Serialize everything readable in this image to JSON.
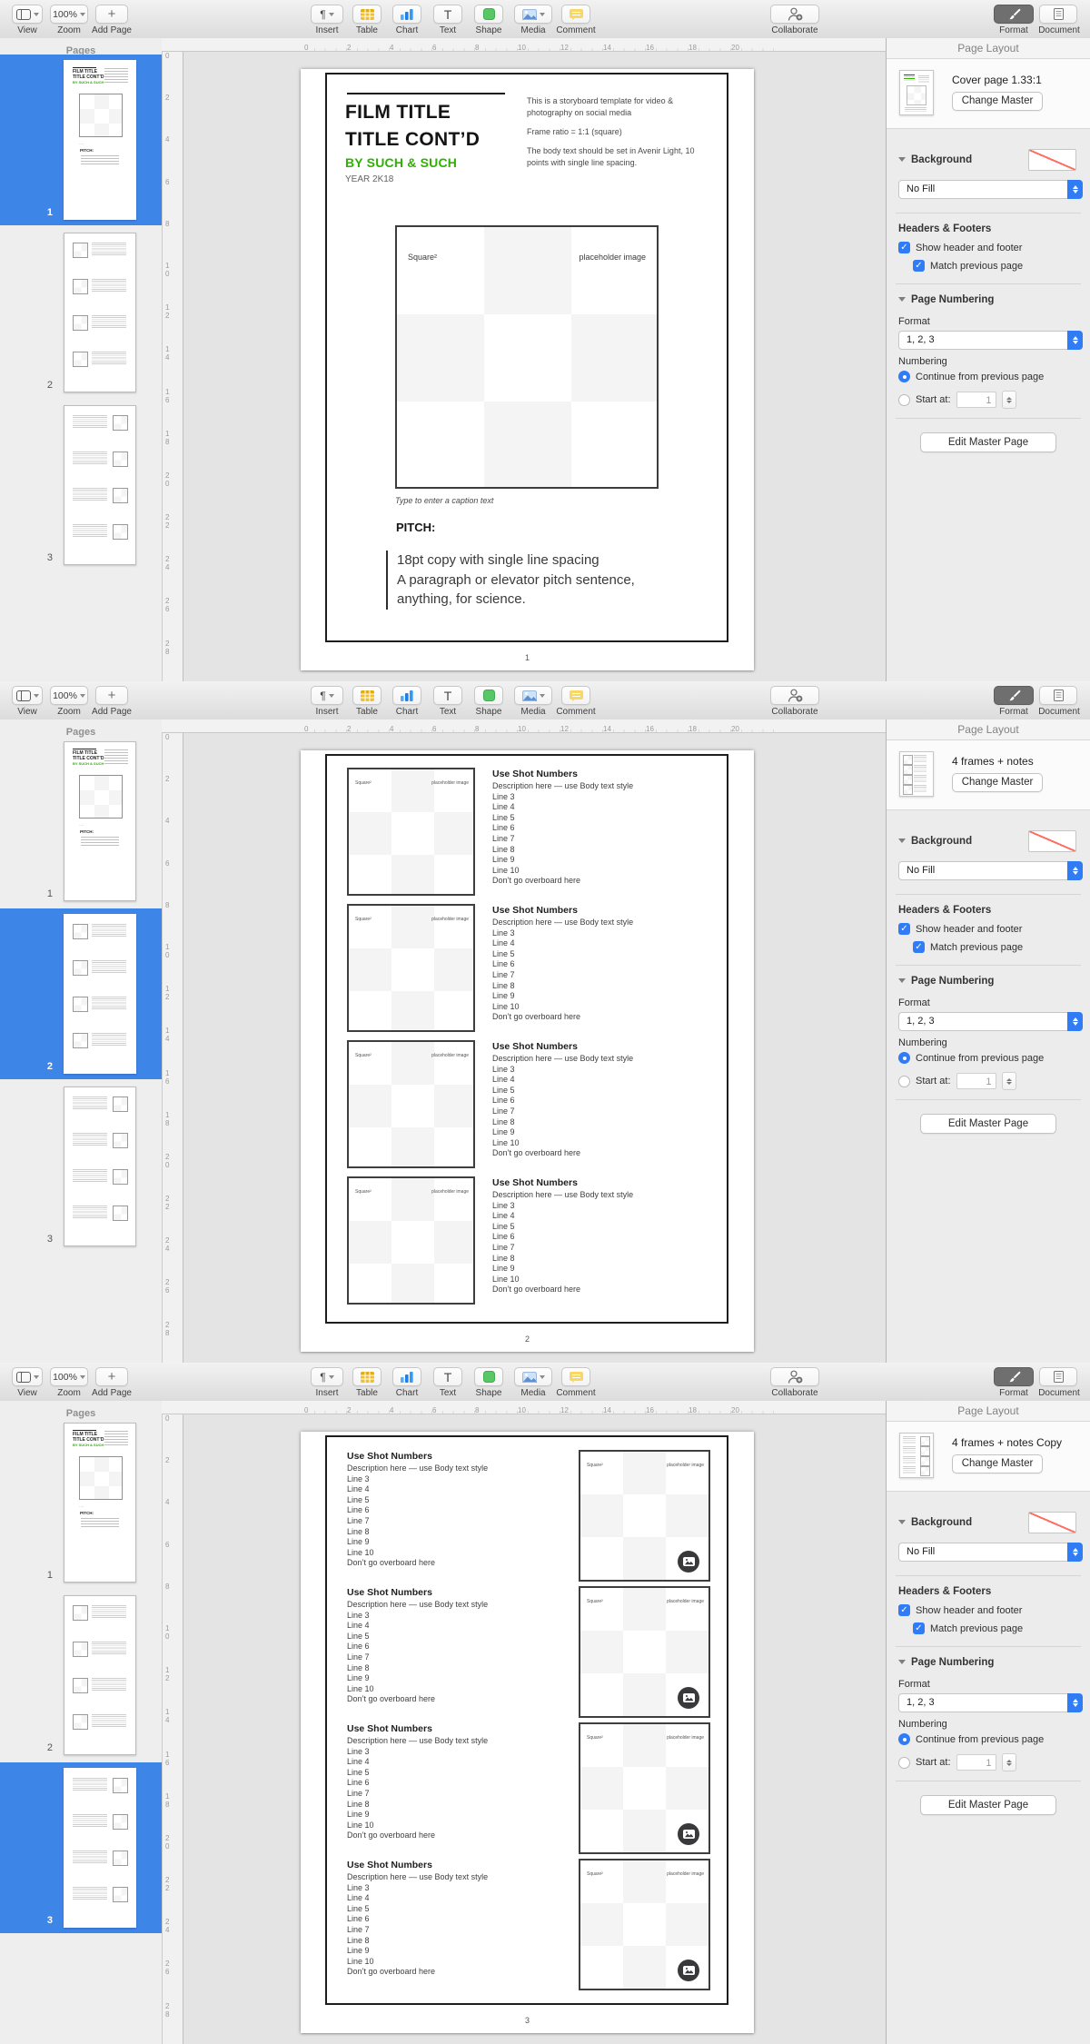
{
  "colors": {
    "selection_blue": "#3e85e8",
    "control_blue": "#2f7cf6",
    "accent_green": "#2db200",
    "no_fill_red": "#ff6e61",
    "table_yellow": "#f2c029",
    "chart_blue": "#2e9bf7",
    "shape_green": "#57c865",
    "comment_yellow": "#f8d864"
  },
  "toolbar": {
    "view_label": "View",
    "zoom_value": "100%",
    "zoom_label": "Zoom",
    "add_page_label": "Add Page",
    "insert_label": "Insert",
    "table_label": "Table",
    "chart_label": "Chart",
    "text_label": "Text",
    "shape_label": "Shape",
    "media_label": "Media",
    "comment_label": "Comment",
    "collaborate_label": "Collaborate",
    "format_label": "Format",
    "document_label": "Document"
  },
  "sidebar": {
    "title": "Pages",
    "page_labels": [
      "1",
      "2",
      "3"
    ]
  },
  "rulers": {
    "horizontal": [
      "0",
      "2",
      "4",
      "6",
      "8",
      "10",
      "12",
      "14",
      "16",
      "18",
      "20"
    ],
    "vertical": [
      "0",
      "2",
      "4",
      "6",
      "8",
      "10",
      "12",
      "14",
      "16",
      "18",
      "20",
      "22",
      "24",
      "26",
      "28"
    ]
  },
  "panel": {
    "title": "Page Layout",
    "change_master": "Change Master",
    "background_label": "Background",
    "background_fill": "No Fill",
    "headers_footers_title": "Headers & Footers",
    "show_header_footer": "Show header and footer",
    "match_previous": "Match previous page",
    "page_numbering_title": "Page Numbering",
    "format_label": "Format",
    "format_value": "1, 2, 3",
    "numbering_label": "Numbering",
    "continue_option": "Continue from previous page",
    "start_at_option": "Start at:",
    "start_at_value": "1",
    "edit_master": "Edit Master Page"
  },
  "sections": [
    {
      "master_name": "Cover page 1.33:1",
      "page_number": "1",
      "selected_page": "1"
    },
    {
      "master_name": "4 frames + notes",
      "page_number": "2",
      "selected_page": "2"
    },
    {
      "master_name": "4 frames + notes Copy",
      "page_number": "3",
      "selected_page": "3"
    }
  ],
  "cover": {
    "title_line1": "FILM TITLE",
    "title_line2": "TITLE CONT’D",
    "byline": "BY SUCH & SUCH",
    "year": "YEAR 2K18",
    "intro_p1": "This is a storyboard template for video & photography on social media",
    "intro_p2": "Frame ratio = 1:1 (square)",
    "intro_p3": "The body text should be set in Avenir Light, 10 points with single line spacing.",
    "square_label": "Square²",
    "placeholder_label": "placeholder image",
    "caption": "Type to enter a caption text",
    "pitch_heading": "PITCH:",
    "pitch_lines": [
      "18pt copy with single line spacing",
      "A paragraph or elevator pitch sentence,",
      "anything, for science."
    ]
  },
  "frames_page": {
    "frame_count": 4,
    "heading": "Use Shot Numbers",
    "lines": [
      "Description here — use Body text style",
      "Line 3",
      "Line 4",
      "Line 5",
      "Line 6",
      "Line 7",
      "Line 8",
      "Line 9",
      "Line 10",
      "Don’t go overboard here"
    ],
    "square_label": "Square²",
    "placeholder_label": "placeholder image"
  }
}
